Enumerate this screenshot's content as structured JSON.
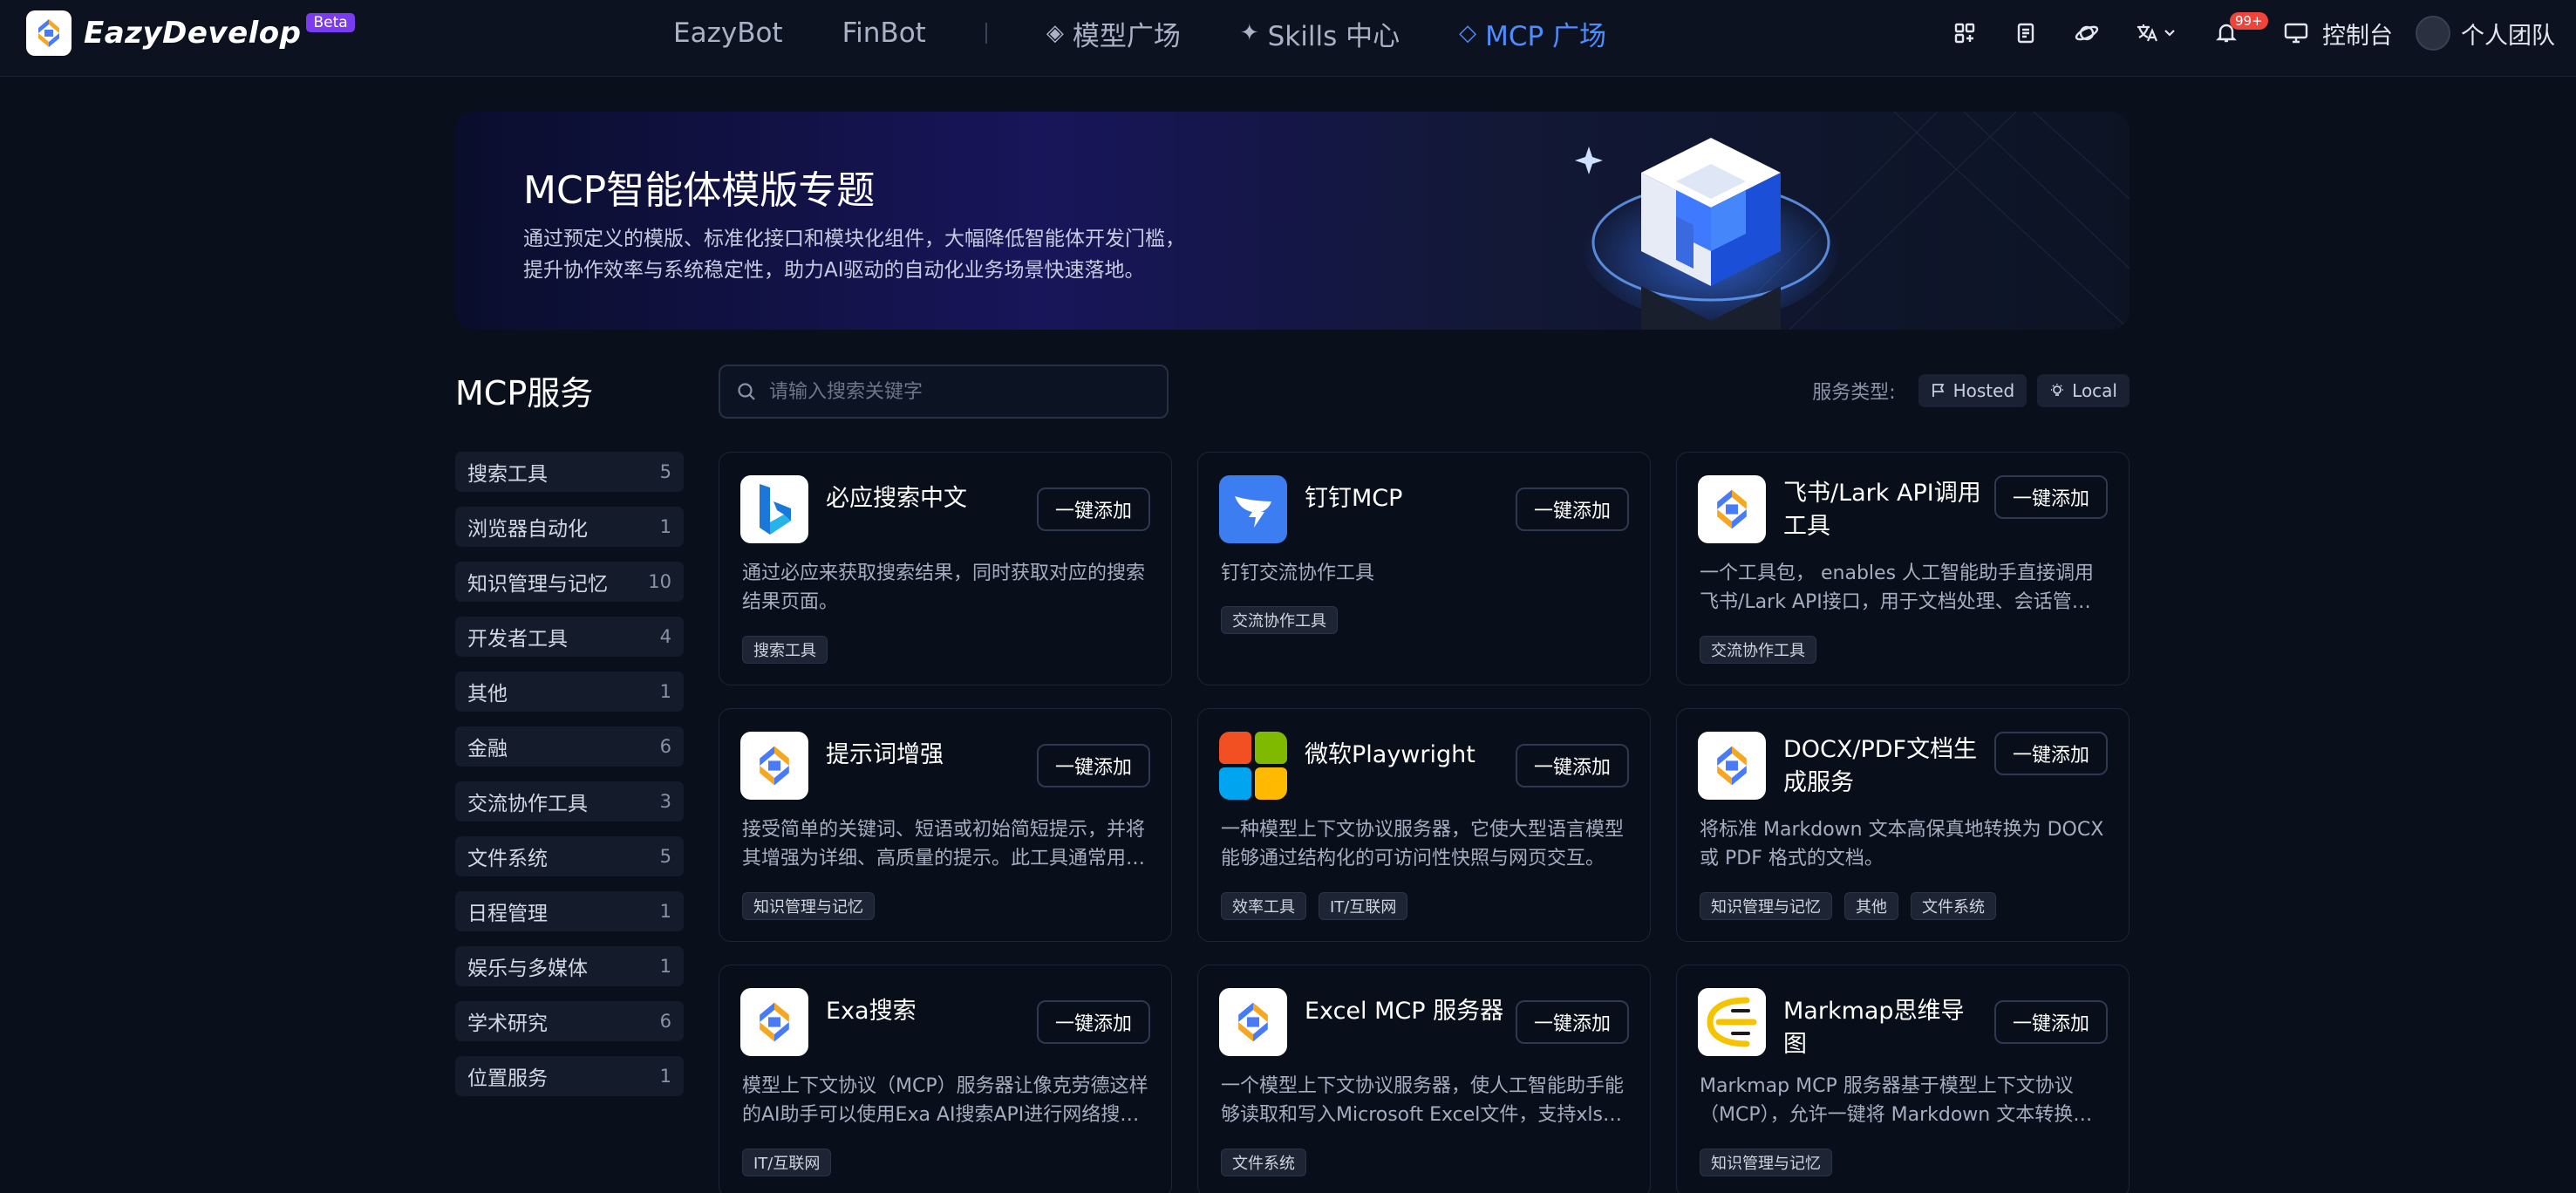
{
  "nav": {
    "brand": "EazyDevelop",
    "badge": "Beta",
    "links": [
      {
        "label": "EazyBot",
        "glyph": ""
      },
      {
        "label": "FinBot",
        "glyph": ""
      },
      {
        "label": "模型广场",
        "glyph": "◈"
      },
      {
        "label": "Skills 中心",
        "glyph": "✦"
      },
      {
        "label": "MCP 广场",
        "glyph": "◇"
      }
    ],
    "notify_badge": "99+",
    "console": "控制台",
    "team": "个人团队"
  },
  "hero": {
    "title": "MCP智能体模版专题",
    "desc_line1": "通过预定义的模版、标准化接口和模块化组件，大幅降低智能体开发门槛，",
    "desc_line2": "提升协作效率与系统稳定性，助力AI驱动的自动化业务场景快速落地。"
  },
  "section_title": "MCP服务",
  "search": {
    "placeholder": "请输入搜索关键字"
  },
  "filter": {
    "label": "服务类型:",
    "hosted": "Hosted",
    "local": "Local"
  },
  "categories": [
    {
      "label": "搜索工具",
      "count": "5"
    },
    {
      "label": "浏览器自动化",
      "count": "1"
    },
    {
      "label": "知识管理与记忆",
      "count": "10"
    },
    {
      "label": "开发者工具",
      "count": "4"
    },
    {
      "label": "其他",
      "count": "1"
    },
    {
      "label": "金融",
      "count": "6"
    },
    {
      "label": "交流协作工具",
      "count": "3"
    },
    {
      "label": "文件系统",
      "count": "5"
    },
    {
      "label": "日程管理",
      "count": "1"
    },
    {
      "label": "娱乐与多媒体",
      "count": "1"
    },
    {
      "label": "学术研究",
      "count": "6"
    },
    {
      "label": "位置服务",
      "count": "1"
    }
  ],
  "add_label": "一键添加",
  "cards": [
    {
      "title": "必应搜索中文",
      "desc": "通过必应来获取搜索结果，同时获取对应的搜索结果页面。",
      "tags": [
        "搜索工具"
      ],
      "logo": "bing-icon"
    },
    {
      "title": "钉钉MCP",
      "desc": "钉钉交流协作工具",
      "tags": [
        "交流协作工具"
      ],
      "logo": "dingtalk-icon"
    },
    {
      "title": "飞书/Lark API调用工具",
      "desc": "一个工具包， enables 人工智能助手直接调用飞书/Lark API接口，用于文档处理、会话管理等。",
      "tags": [
        "交流协作工具"
      ],
      "logo": "eazy-icon"
    },
    {
      "title": "提示词增强",
      "desc": "接受简单的关键词、短语或初始简短提示，并将其增强为详细、高质量的提示。此工具通常用于提示工程。",
      "tags": [
        "知识管理与记忆"
      ],
      "logo": "eazy-icon"
    },
    {
      "title": "微软Playwright",
      "desc": "一种模型上下文协议服务器，它使大型语言模型能够通过结构化的可访问性快照与网页交互。",
      "tags": [
        "效率工具",
        "IT/互联网"
      ],
      "logo": "microsoft-icon"
    },
    {
      "title": "DOCX/PDF文档生成服务",
      "desc": "将标准 Markdown 文本高保真地转换为 DOCX 或 PDF 格式的文档。",
      "tags": [
        "知识管理与记忆",
        "其他",
        "文件系统"
      ],
      "logo": "eazy-icon"
    },
    {
      "title": "Exa搜索",
      "desc": "模型上下文协议（MCP）服务器让像克劳德这样的AI助手可以使用Exa AI搜索API进行网络搜索。",
      "tags": [
        "IT/互联网"
      ],
      "logo": "eazy-icon"
    },
    {
      "title": "Excel MCP 服务器",
      "desc": "一个模型上下文协议服务器，使人工智能助手能够读取和写入Microsoft Excel文件，支持xlsx格式。",
      "tags": [
        "文件系统"
      ],
      "logo": "eazy-icon"
    },
    {
      "title": "Markmap思维导图",
      "desc": "Markmap MCP 服务器基于模型上下文协议（MCP），允许一键将 Markdown 文本转换为思维导图。",
      "tags": [
        "知识管理与记忆"
      ],
      "logo": "markmap-icon"
    }
  ]
}
